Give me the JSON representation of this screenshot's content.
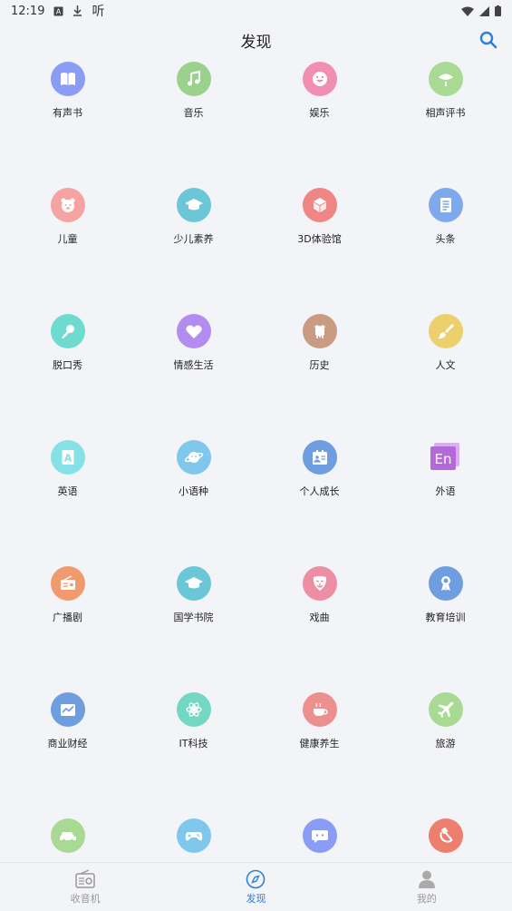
{
  "status_bar": {
    "time": "12:19",
    "app_indicator": "听"
  },
  "header": {
    "title": "发现"
  },
  "colors": {
    "accent": "#2f7fd8",
    "inactive": "#999999"
  },
  "categories": [
    {
      "label": "有声书",
      "icon": "book-icon",
      "color": "#8b9cf4"
    },
    {
      "label": "音乐",
      "icon": "music-icon",
      "color": "#9ad18c"
    },
    {
      "label": "娱乐",
      "icon": "smile-icon",
      "color": "#f08fb0"
    },
    {
      "label": "相声评书",
      "icon": "fan-icon",
      "color": "#a9da94"
    },
    {
      "label": "儿童",
      "icon": "bear-icon",
      "color": "#f6a3a3"
    },
    {
      "label": "少儿素养",
      "icon": "graduation-cap-icon",
      "color": "#6bc6d8"
    },
    {
      "label": "3D体验馆",
      "icon": "cube-icon",
      "color": "#f08585"
    },
    {
      "label": "头条",
      "icon": "news-icon",
      "color": "#7ea9ec"
    },
    {
      "label": "脱口秀",
      "icon": "microphone-icon",
      "color": "#6fdad0"
    },
    {
      "label": "情感生活",
      "icon": "heart-icon",
      "color": "#b38cf0"
    },
    {
      "label": "历史",
      "icon": "bell-icon",
      "color": "#c99b82"
    },
    {
      "label": "人文",
      "icon": "brush-icon",
      "color": "#ecd06e"
    },
    {
      "label": "英语",
      "icon": "letter-a-icon",
      "color": "#86e1e6"
    },
    {
      "label": "小语种",
      "icon": "planet-icon",
      "color": "#7fc8ec"
    },
    {
      "label": "个人成长",
      "icon": "id-card-icon",
      "color": "#6f9ee0"
    },
    {
      "label": "外语",
      "icon": "en-icon",
      "color": "#b36ad8"
    },
    {
      "label": "广播剧",
      "icon": "radio-icon",
      "color": "#f09a6e"
    },
    {
      "label": "国学书院",
      "icon": "graduation-cap-icon",
      "color": "#6bc6d8"
    },
    {
      "label": "戏曲",
      "icon": "opera-mask-icon",
      "color": "#ec8fa4"
    },
    {
      "label": "教育培训",
      "icon": "ribbon-icon",
      "color": "#6f9ee0"
    },
    {
      "label": "商业财经",
      "icon": "chart-icon",
      "color": "#6f9ee0"
    },
    {
      "label": "IT科技",
      "icon": "atom-icon",
      "color": "#72d8c4"
    },
    {
      "label": "健康养生",
      "icon": "cup-icon",
      "color": "#ec8f8f"
    },
    {
      "label": "旅游",
      "icon": "airplane-icon",
      "color": "#a9da94"
    },
    {
      "label": "",
      "icon": "car-icon",
      "color": "#a9da94"
    },
    {
      "label": "",
      "icon": "gamepad-icon",
      "color": "#7fc8ec"
    },
    {
      "label": "",
      "icon": "chat-icon",
      "color": "#8b9cf4"
    },
    {
      "label": "",
      "icon": "hammer-sickle-icon",
      "color": "#ec7f6e"
    }
  ],
  "tabs": [
    {
      "label": "收音机",
      "icon": "radio-icon",
      "active": false
    },
    {
      "label": "发现",
      "icon": "compass-icon",
      "active": true
    },
    {
      "label": "我的",
      "icon": "person-icon",
      "active": false
    }
  ]
}
